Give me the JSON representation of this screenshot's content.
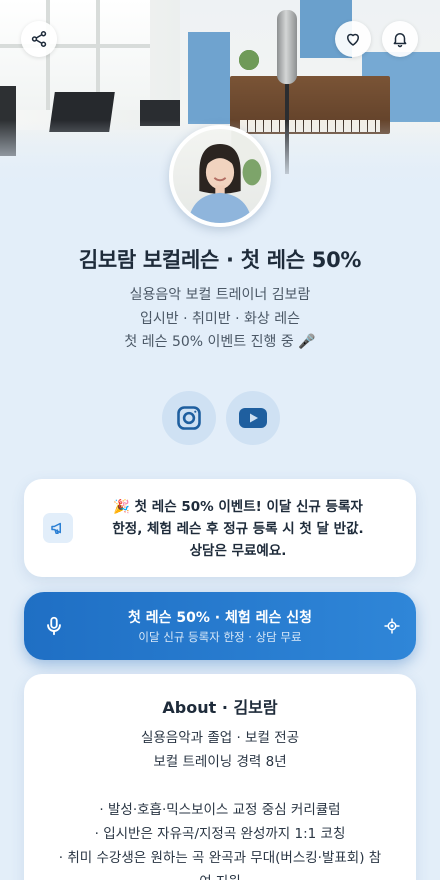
{
  "profile": {
    "title": "김보람 보컬레슨 · 첫 레슨 50%",
    "subtitle_lines": [
      "실용음악 보컬 트레이너 김보람",
      "입시반 · 취미반 · 화상 레슨",
      "첫 레슨 50% 이벤트 진행 중 🎤"
    ]
  },
  "icons": {
    "share": "share-icon",
    "heart": "heart-icon",
    "bell": "bell-icon",
    "instagram": "instagram-icon",
    "youtube": "youtube-icon",
    "megaphone": "megaphone-icon",
    "mic": "microphone-icon",
    "target": "crosshair-icon"
  },
  "notice": {
    "lines": [
      "🎉 첫 레슨 50% 이벤트! 이달 신규 등록자",
      "한정, 체험 레슨 후 정규 등록 시 첫 달 반값.",
      "상담은 무료예요."
    ]
  },
  "cta": {
    "main": "첫 레슨 50% · 체험 레슨 신청",
    "sub": "이달 신규 등록자 한정 · 상담 무료"
  },
  "about": {
    "title": "About · 김보람",
    "lines": [
      "실용음악과 졸업 · 보컬 전공",
      "보컬 트레이닝 경력 8년",
      "",
      "· 발성·호흡·믹스보이스 교정 중심 커리큘럼",
      "· 입시반은 자유곡/지정곡 완성까지 1:1 코칭",
      "· 취미 수강생은 원하는 곡 완곡과 무대(버스킹·발표회) 참",
      "여 지원"
    ]
  },
  "colors": {
    "accent": "#2a7fd4",
    "background": "#e3eef9",
    "card": "#ffffff",
    "text": "#1e2b3a"
  }
}
